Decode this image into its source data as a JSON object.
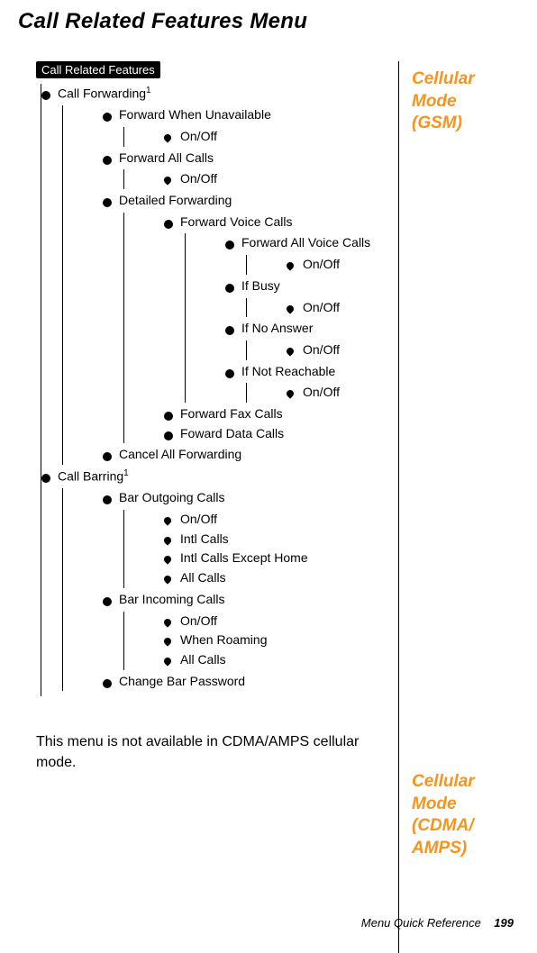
{
  "page_title": "Call Related Features Menu",
  "sidebar": {
    "block1_lines": [
      "Cellular",
      "Mode",
      "(GSM)"
    ],
    "block2_lines": [
      "Cellular",
      "Mode",
      "(CDMA/",
      "AMPS)"
    ]
  },
  "badge": "Call Related Features",
  "tree": {
    "call_forwarding": {
      "label": "Call Forwarding",
      "sup": "1",
      "children": {
        "fwu": {
          "label": "Forward When Unavailable",
          "leaf": "On/Off"
        },
        "fac": {
          "label": "Forward All Calls",
          "leaf": "On/Off"
        },
        "df": {
          "label": "Detailed Forwarding",
          "children": {
            "fvc": {
              "label": "Forward Voice Calls",
              "children": {
                "favc": {
                  "label": "Forward All Voice Calls",
                  "leaf": "On/Off"
                },
                "ib": {
                  "label": "If Busy",
                  "leaf": "On/Off"
                },
                "ina": {
                  "label": "If No Answer",
                  "leaf": "On/Off"
                },
                "inr": {
                  "label": "If Not Reachable",
                  "leaf": "On/Off"
                }
              }
            },
            "ffc": {
              "label": "Forward Fax Calls"
            },
            "fdc": {
              "label": "Foward Data Calls"
            }
          }
        },
        "caf": {
          "label": "Cancel All Forwarding"
        }
      }
    },
    "call_barring": {
      "label": "Call Barring",
      "sup": "1",
      "children": {
        "boc": {
          "label": "Bar Outgoing Calls",
          "leaves": [
            "On/Off",
            "Intl Calls",
            "Intl Calls Except Home",
            "All Calls"
          ]
        },
        "bic": {
          "label": "Bar Incoming Calls",
          "leaves": [
            "On/Off",
            "When Roaming",
            "All Calls"
          ]
        },
        "cbp": {
          "label": "Change Bar Password"
        }
      }
    }
  },
  "cdma_note": "This menu is not available in CDMA/AMPS cellular mode.",
  "footer_text": "Menu Quick Reference",
  "page_number": "199"
}
